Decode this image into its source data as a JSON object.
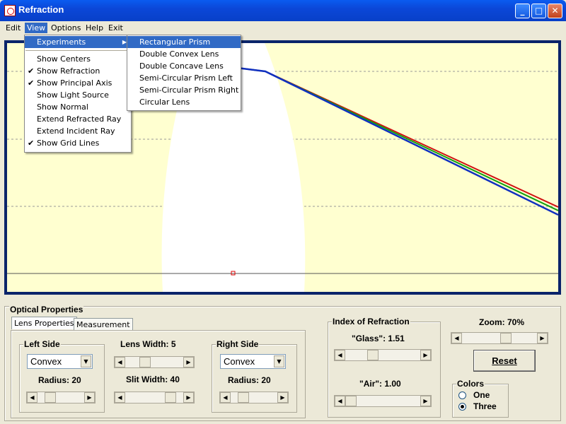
{
  "window": {
    "title": "Refraction",
    "minimize": "_",
    "maximize": "□",
    "close": "✕"
  },
  "menubar": {
    "edit": "Edit",
    "view": "View",
    "options": "Options",
    "help": "Help",
    "exit": "Exit"
  },
  "view_menu": {
    "items": [
      {
        "label": "Experiments",
        "checked": false,
        "submenu": true
      },
      {
        "label": "Show Centers",
        "checked": false
      },
      {
        "label": "Show Refraction",
        "checked": true
      },
      {
        "label": "Show Principal Axis",
        "checked": true
      },
      {
        "label": "Show Light Source",
        "checked": false
      },
      {
        "label": "Show Normal",
        "checked": false
      },
      {
        "label": "Extend Refracted Ray",
        "checked": false
      },
      {
        "label": "Extend Incident Ray",
        "checked": false
      },
      {
        "label": "Show Grid Lines",
        "checked": true
      }
    ]
  },
  "experiments_menu": {
    "items": [
      "Rectangular Prism",
      "Double Convex Lens",
      "Double Concave Lens",
      "Semi-Circular Prism Left",
      "Semi-Circular Prism Right",
      "Circular Lens"
    ],
    "highlighted": "Rectangular Prism"
  },
  "canvas": {
    "background": "#ffffd0",
    "lens_color": "#ffffff",
    "ray_colors": [
      "#d01010",
      "#10a010",
      "#1030c0"
    ]
  },
  "panel": {
    "title": "Optical Properties",
    "tabs": {
      "lens": "Lens Properties",
      "measurement": "Measurement"
    },
    "left_side": {
      "title": "Left Side",
      "shape": "Convex",
      "radius_label": "Radius: 20",
      "radius_fraction": 0.2
    },
    "lens_width": {
      "label": "Lens Width:  5",
      "fraction": 0.3
    },
    "slit_width": {
      "label": "Slit Width: 40",
      "fraction": 0.85
    },
    "right_side": {
      "title": "Right Side",
      "shape": "Convex",
      "radius_label": "Radius: 20",
      "radius_fraction": 0.2
    },
    "index": {
      "title": "Index of Refraction",
      "glass_label": "\"Glass\": 1.51",
      "glass_fraction": 0.35,
      "air_label": "\"Air\": 1.00",
      "air_fraction": 0.0
    },
    "zoom": {
      "label": "Zoom: 70%",
      "fraction": 0.6
    },
    "reset": "Reset",
    "colors": {
      "title": "Colors",
      "one": "One",
      "three": "Three",
      "selected": "Three"
    }
  }
}
